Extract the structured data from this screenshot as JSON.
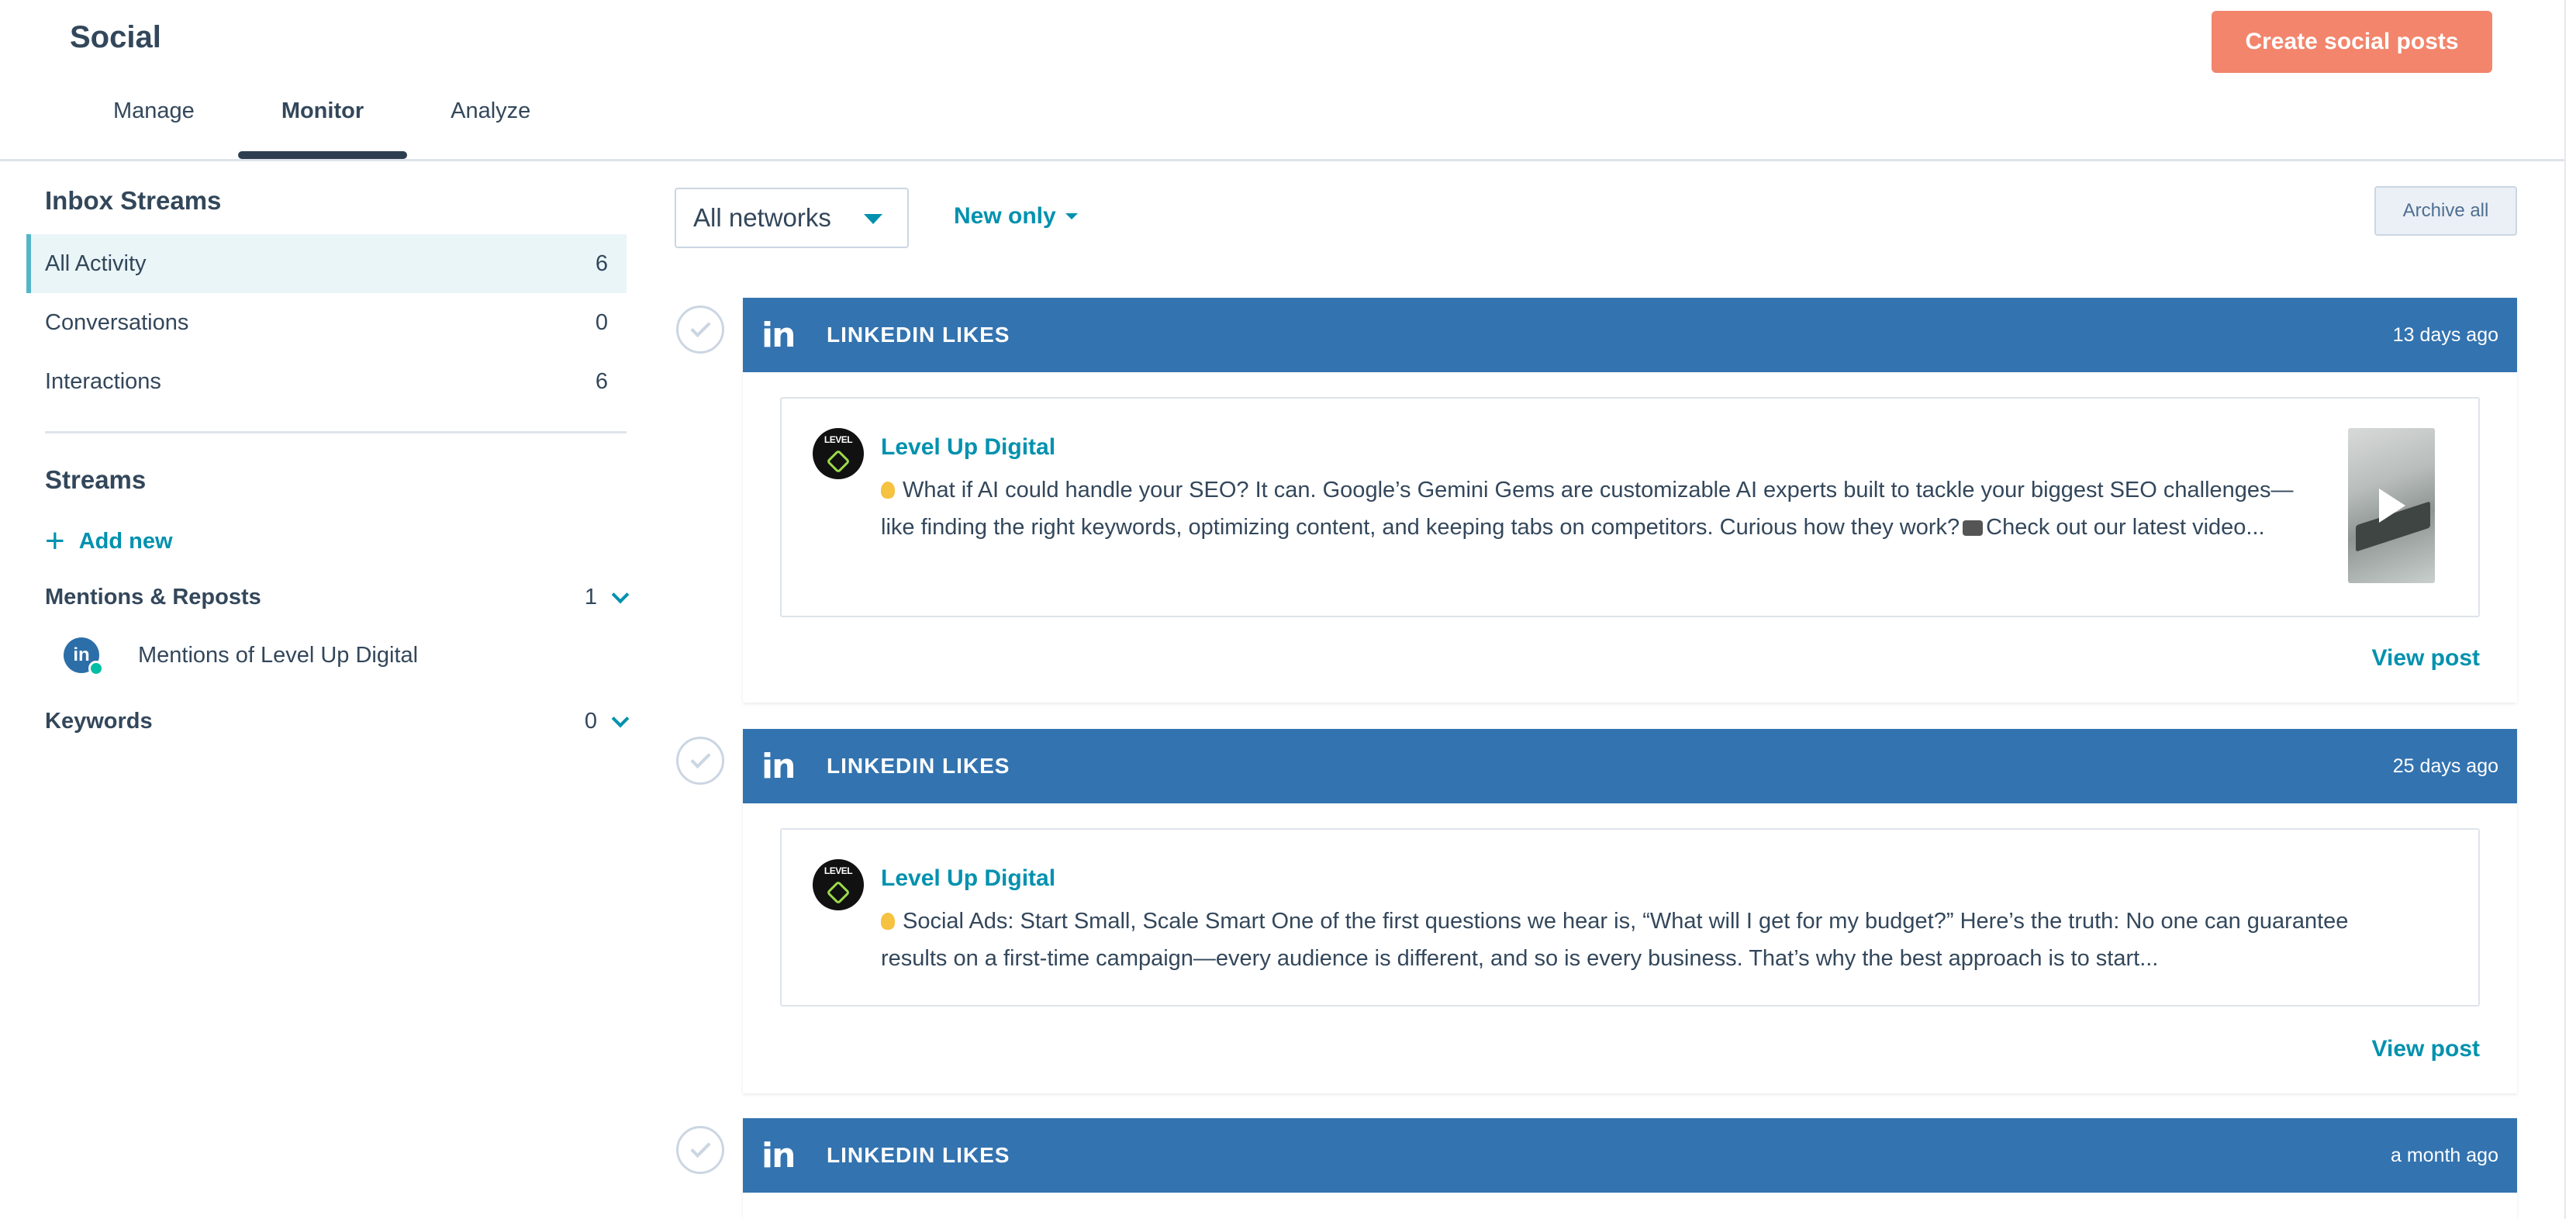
{
  "header": {
    "title": "Social",
    "create_button": "Create social posts",
    "tabs": [
      {
        "label": "Manage",
        "active": false
      },
      {
        "label": "Monitor",
        "active": true
      },
      {
        "label": "Analyze",
        "active": false
      }
    ]
  },
  "sidebar": {
    "inbox_heading": "Inbox Streams",
    "inbox_items": [
      {
        "label": "All Activity",
        "count": "6",
        "active": true
      },
      {
        "label": "Conversations",
        "count": "0",
        "active": false
      },
      {
        "label": "Interactions",
        "count": "6",
        "active": false
      }
    ],
    "streams_heading": "Streams",
    "add_new": "Add new",
    "groups": [
      {
        "label": "Mentions & Reposts",
        "count": "1"
      },
      {
        "label": "Keywords",
        "count": "0"
      }
    ],
    "mention_stream": {
      "label": "Mentions of Level Up Digital",
      "icon": "linkedin-icon",
      "badge_text": "in"
    }
  },
  "toolbar": {
    "network_select": "All networks",
    "filter": "New only",
    "archive_all": "Archive all"
  },
  "feed": [
    {
      "network_icon": "in",
      "type": "LINKEDIN LIKES",
      "time": "13 days ago",
      "author": "Level Up Digital",
      "avatar_text": "LEVEL",
      "line1": "What if AI could handle your SEO? It can. Google’s Gemini Gems are customizable AI experts built to tackle your biggest SEO challenges—",
      "line2a": "like finding the right keywords, optimizing content, and keeping tabs on competitors. Curious how they work?",
      "line2b": "Check out our latest video...",
      "has_thumbnail": true,
      "view_post": "View post"
    },
    {
      "network_icon": "in",
      "type": "LINKEDIN LIKES",
      "time": "25 days ago",
      "author": "Level Up Digital",
      "avatar_text": "LEVEL",
      "line1": "Social Ads: Start Small, Scale Smart One of the first questions we hear is, “What will I get for my budget?” Here’s the truth: No one can guarantee",
      "line2": "results on a first-time campaign—every audience is different, and so is every business. That’s why the best approach is to start...",
      "has_thumbnail": false,
      "view_post": "View post"
    },
    {
      "network_icon": "in",
      "type": "LINKEDIN LIKES",
      "time": "a month ago"
    }
  ],
  "colors": {
    "accent": "#0091ae",
    "primary_button": "#f2856c",
    "card_header": "#3373b0",
    "active_stream_bg": "#eaf5f8",
    "active_stream_border": "#54b5c9"
  }
}
